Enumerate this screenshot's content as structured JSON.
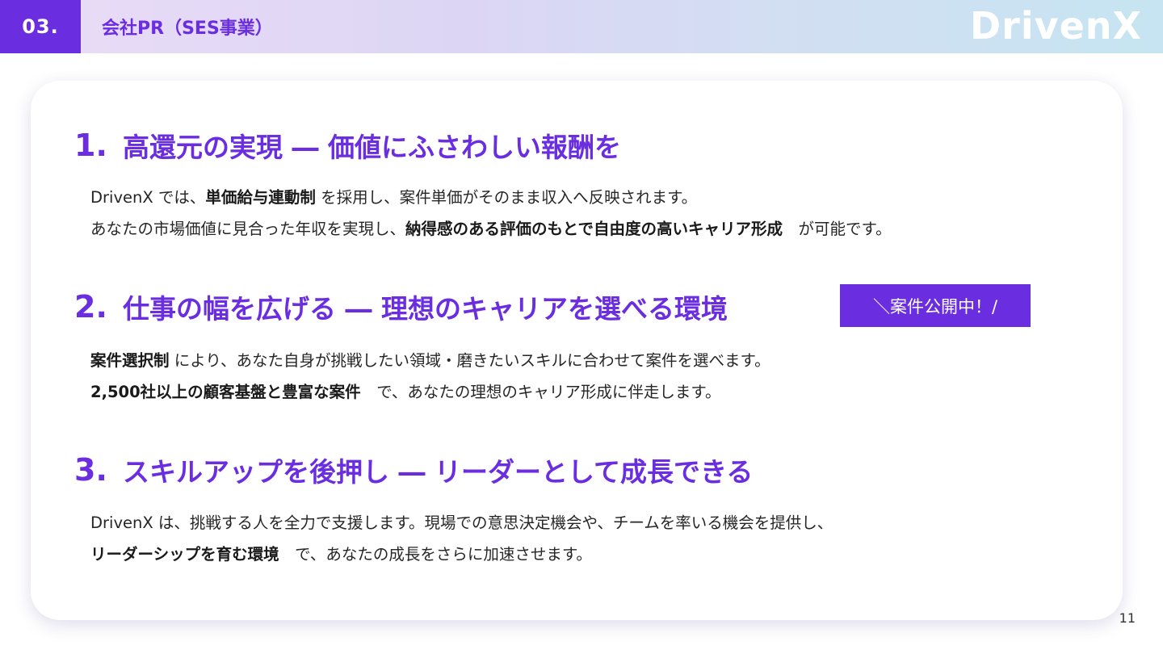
{
  "header": {
    "section_number": "03.",
    "section_title": "会社PR（SES事業）",
    "logo": "DrivenX"
  },
  "sections": [
    {
      "number": "1.",
      "title": "高還元の実現 ― 価値にふさわしい報酬を",
      "lines": [
        {
          "a": "DrivenX では、",
          "b": "単価給与連動制",
          "c": " を採用し、案件単価がそのまま収入へ反映されます。"
        },
        {
          "a": "あなたの市場価値に見合った年収を実現し、",
          "b": "納得感のある評価のもとで自由度の高いキャリア形成",
          "c": "　が可能です。"
        }
      ]
    },
    {
      "number": "2.",
      "title": "仕事の幅を広げる ― 理想のキャリアを選べる環境",
      "badge": "＼案件公開中！/",
      "lines": [
        {
          "a": "",
          "b": "案件選択制",
          "c": " により、あなた自身が挑戦したい領域・磨きたいスキルに合わせて案件を選べます。"
        },
        {
          "a": "",
          "b": "2,500社以上の顧客基盤と豊富な案件",
          "c": "　で、あなたの理想のキャリア形成に伴走します。"
        }
      ]
    },
    {
      "number": "3.",
      "title": "スキルアップを後押し ― リーダーとして成長できる",
      "lines": [
        {
          "a": "DrivenX は、挑戦する人を全力で支援します。現場での意思決定機会や、チームを率いる機会を提供し、",
          "b": "",
          "c": ""
        },
        {
          "a": "",
          "b": "リーダーシップを育む環境",
          "c": "　で、あなたの成長をさらに加速させます。"
        }
      ]
    }
  ],
  "page_number": "11",
  "colors": {
    "accent": "#6a2ee0",
    "header_gradient_start": "#eadcf7",
    "header_gradient_end": "#c6e4f1"
  }
}
